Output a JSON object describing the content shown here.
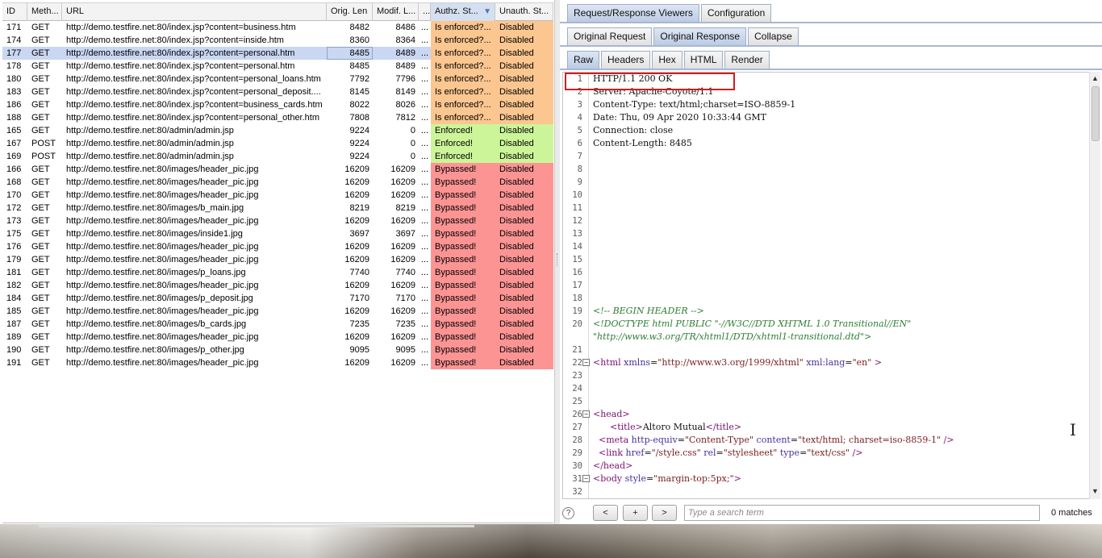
{
  "table": {
    "columns": {
      "id": "ID",
      "method": "Meth...",
      "url": "URL",
      "orig_len": "Orig. Len",
      "modif_len": "Modif. L...",
      "dots": "...",
      "authz": "Authz. St...",
      "unauth": "Unauth. St..."
    },
    "sort_indicator": "▼",
    "rows": [
      {
        "id": "171",
        "method": "GET",
        "url": "http://demo.testfire.net:80/index.jsp?content=business.htm",
        "orig": "8482",
        "modif": "8486",
        "dots": "...",
        "authz": "Is enforced?...",
        "unauth": "Disabled",
        "status": "orange"
      },
      {
        "id": "174",
        "method": "GET",
        "url": "http://demo.testfire.net:80/index.jsp?content=inside.htm",
        "orig": "8360",
        "modif": "8364",
        "dots": "...",
        "authz": "Is enforced?...",
        "unauth": "Disabled",
        "status": "orange"
      },
      {
        "id": "177",
        "method": "GET",
        "url": "http://demo.testfire.net:80/index.jsp?content=personal.htm",
        "orig": "8485",
        "modif": "8489",
        "dots": "...",
        "authz": "Is enforced?...",
        "unauth": "Disabled",
        "status": "orange",
        "selected": true
      },
      {
        "id": "178",
        "method": "GET",
        "url": "http://demo.testfire.net:80/index.jsp?content=personal.htm",
        "orig": "8485",
        "modif": "8489",
        "dots": "...",
        "authz": "Is enforced?...",
        "unauth": "Disabled",
        "status": "orange"
      },
      {
        "id": "180",
        "method": "GET",
        "url": "http://demo.testfire.net:80/index.jsp?content=personal_loans.htm",
        "orig": "7792",
        "modif": "7796",
        "dots": "...",
        "authz": "Is enforced?...",
        "unauth": "Disabled",
        "status": "orange"
      },
      {
        "id": "183",
        "method": "GET",
        "url": "http://demo.testfire.net:80/index.jsp?content=personal_deposit....",
        "orig": "8145",
        "modif": "8149",
        "dots": "...",
        "authz": "Is enforced?...",
        "unauth": "Disabled",
        "status": "orange"
      },
      {
        "id": "186",
        "method": "GET",
        "url": "http://demo.testfire.net:80/index.jsp?content=business_cards.htm",
        "orig": "8022",
        "modif": "8026",
        "dots": "...",
        "authz": "Is enforced?...",
        "unauth": "Disabled",
        "status": "orange"
      },
      {
        "id": "188",
        "method": "GET",
        "url": "http://demo.testfire.net:80/index.jsp?content=personal_other.htm",
        "orig": "7808",
        "modif": "7812",
        "dots": "...",
        "authz": "Is enforced?...",
        "unauth": "Disabled",
        "status": "orange"
      },
      {
        "id": "165",
        "method": "GET",
        "url": "http://demo.testfire.net:80/admin/admin.jsp",
        "orig": "9224",
        "modif": "0",
        "dots": "...",
        "authz": "Enforced!",
        "unauth": "Disabled",
        "status": "green"
      },
      {
        "id": "167",
        "method": "POST",
        "url": "http://demo.testfire.net:80/admin/admin.jsp",
        "orig": "9224",
        "modif": "0",
        "dots": "...",
        "authz": "Enforced!",
        "unauth": "Disabled",
        "status": "green"
      },
      {
        "id": "169",
        "method": "POST",
        "url": "http://demo.testfire.net:80/admin/admin.jsp",
        "orig": "9224",
        "modif": "0",
        "dots": "...",
        "authz": "Enforced!",
        "unauth": "Disabled",
        "status": "green"
      },
      {
        "id": "166",
        "method": "GET",
        "url": "http://demo.testfire.net:80/images/header_pic.jpg",
        "orig": "16209",
        "modif": "16209",
        "dots": "...",
        "authz": "Bypassed!",
        "unauth": "Disabled",
        "status": "red"
      },
      {
        "id": "168",
        "method": "GET",
        "url": "http://demo.testfire.net:80/images/header_pic.jpg",
        "orig": "16209",
        "modif": "16209",
        "dots": "...",
        "authz": "Bypassed!",
        "unauth": "Disabled",
        "status": "red"
      },
      {
        "id": "170",
        "method": "GET",
        "url": "http://demo.testfire.net:80/images/header_pic.jpg",
        "orig": "16209",
        "modif": "16209",
        "dots": "...",
        "authz": "Bypassed!",
        "unauth": "Disabled",
        "status": "red"
      },
      {
        "id": "172",
        "method": "GET",
        "url": "http://demo.testfire.net:80/images/b_main.jpg",
        "orig": "8219",
        "modif": "8219",
        "dots": "...",
        "authz": "Bypassed!",
        "unauth": "Disabled",
        "status": "red"
      },
      {
        "id": "173",
        "method": "GET",
        "url": "http://demo.testfire.net:80/images/header_pic.jpg",
        "orig": "16209",
        "modif": "16209",
        "dots": "...",
        "authz": "Bypassed!",
        "unauth": "Disabled",
        "status": "red"
      },
      {
        "id": "175",
        "method": "GET",
        "url": "http://demo.testfire.net:80/images/inside1.jpg",
        "orig": "3697",
        "modif": "3697",
        "dots": "...",
        "authz": "Bypassed!",
        "unauth": "Disabled",
        "status": "red"
      },
      {
        "id": "176",
        "method": "GET",
        "url": "http://demo.testfire.net:80/images/header_pic.jpg",
        "orig": "16209",
        "modif": "16209",
        "dots": "...",
        "authz": "Bypassed!",
        "unauth": "Disabled",
        "status": "red"
      },
      {
        "id": "179",
        "method": "GET",
        "url": "http://demo.testfire.net:80/images/header_pic.jpg",
        "orig": "16209",
        "modif": "16209",
        "dots": "...",
        "authz": "Bypassed!",
        "unauth": "Disabled",
        "status": "red"
      },
      {
        "id": "181",
        "method": "GET",
        "url": "http://demo.testfire.net:80/images/p_loans.jpg",
        "orig": "7740",
        "modif": "7740",
        "dots": "...",
        "authz": "Bypassed!",
        "unauth": "Disabled",
        "status": "red"
      },
      {
        "id": "182",
        "method": "GET",
        "url": "http://demo.testfire.net:80/images/header_pic.jpg",
        "orig": "16209",
        "modif": "16209",
        "dots": "...",
        "authz": "Bypassed!",
        "unauth": "Disabled",
        "status": "red"
      },
      {
        "id": "184",
        "method": "GET",
        "url": "http://demo.testfire.net:80/images/p_deposit.jpg",
        "orig": "7170",
        "modif": "7170",
        "dots": "...",
        "authz": "Bypassed!",
        "unauth": "Disabled",
        "status": "red"
      },
      {
        "id": "185",
        "method": "GET",
        "url": "http://demo.testfire.net:80/images/header_pic.jpg",
        "orig": "16209",
        "modif": "16209",
        "dots": "...",
        "authz": "Bypassed!",
        "unauth": "Disabled",
        "status": "red"
      },
      {
        "id": "187",
        "method": "GET",
        "url": "http://demo.testfire.net:80/images/b_cards.jpg",
        "orig": "7235",
        "modif": "7235",
        "dots": "...",
        "authz": "Bypassed!",
        "unauth": "Disabled",
        "status": "red"
      },
      {
        "id": "189",
        "method": "GET",
        "url": "http://demo.testfire.net:80/images/header_pic.jpg",
        "orig": "16209",
        "modif": "16209",
        "dots": "...",
        "authz": "Bypassed!",
        "unauth": "Disabled",
        "status": "red"
      },
      {
        "id": "190",
        "method": "GET",
        "url": "http://demo.testfire.net:80/images/p_other.jpg",
        "orig": "9095",
        "modif": "9095",
        "dots": "...",
        "authz": "Bypassed!",
        "unauth": "Disabled",
        "status": "red"
      },
      {
        "id": "191",
        "method": "GET",
        "url": "http://demo.testfire.net:80/images/header_pic.jpg",
        "orig": "16209",
        "modif": "16209",
        "dots": "...",
        "authz": "Bypassed!",
        "unauth": "Disabled",
        "status": "red"
      }
    ]
  },
  "status_colors": {
    "orange": "#fbc690",
    "green": "#ccf599",
    "red": "#fd9494",
    "selected": "#c9d7f2"
  },
  "tabs": {
    "outer": [
      {
        "label": "Request/Response Viewers",
        "active": true
      },
      {
        "label": "Configuration",
        "active": false
      }
    ],
    "response": [
      {
        "label": "Original Request",
        "active": false
      },
      {
        "label": "Original Response",
        "active": true
      },
      {
        "label": "Collapse",
        "active": false
      }
    ],
    "view": [
      {
        "label": "Raw",
        "active": true
      },
      {
        "label": "Headers",
        "active": false
      },
      {
        "label": "Hex",
        "active": false
      },
      {
        "label": "HTML",
        "active": false
      },
      {
        "label": "Render",
        "active": false
      }
    ]
  },
  "editor": {
    "lines": [
      {
        "n": "1",
        "segs": [
          [
            "plain",
            "HTTP/1.1 200 OK"
          ]
        ]
      },
      {
        "n": "2",
        "segs": [
          [
            "plain",
            "Server: Apache-Coyote/1.1"
          ]
        ]
      },
      {
        "n": "3",
        "segs": [
          [
            "plain",
            "Content-Type: text/html;charset=ISO-8859-1"
          ]
        ]
      },
      {
        "n": "4",
        "segs": [
          [
            "plain",
            "Date: Thu, 09 Apr 2020 10:33:44 GMT"
          ]
        ]
      },
      {
        "n": "5",
        "segs": [
          [
            "plain",
            "Connection: close"
          ]
        ]
      },
      {
        "n": "6",
        "segs": [
          [
            "plain",
            "Content-Length: 8485"
          ]
        ]
      },
      {
        "n": "7",
        "segs": []
      },
      {
        "n": "8",
        "segs": []
      },
      {
        "n": "9",
        "segs": []
      },
      {
        "n": "10",
        "segs": []
      },
      {
        "n": "11",
        "segs": []
      },
      {
        "n": "12",
        "segs": []
      },
      {
        "n": "13",
        "segs": []
      },
      {
        "n": "14",
        "segs": []
      },
      {
        "n": "15",
        "segs": []
      },
      {
        "n": "16",
        "segs": []
      },
      {
        "n": "17",
        "segs": []
      },
      {
        "n": "18",
        "segs": []
      },
      {
        "n": "19",
        "segs": [
          [
            "comment",
            "<!-- BEGIN HEADER -->"
          ]
        ]
      },
      {
        "n": "20",
        "segs": [
          [
            "comment",
            "<!DOCTYPE html PUBLIC \"-//W3C//DTD XHTML 1.0 Transitional//EN\""
          ]
        ]
      },
      {
        "n": "",
        "segs": [
          [
            "comment",
            "\"http://www.w3.org/TR/xhtml1/DTD/xhtml1-transitional.dtd\">"
          ]
        ]
      },
      {
        "n": "21",
        "segs": []
      },
      {
        "n": "22",
        "fold": "−",
        "segs": [
          [
            "tag",
            "<html "
          ],
          [
            "attr",
            "xmlns"
          ],
          [
            "plain",
            "="
          ],
          [
            "val",
            "\"http://www.w3.org/1999/xhtml\""
          ],
          [
            "plain",
            " "
          ],
          [
            "attr",
            "xml:lang"
          ],
          [
            "plain",
            "="
          ],
          [
            "val",
            "\"en\""
          ],
          [
            "tag",
            " >"
          ]
        ]
      },
      {
        "n": "23",
        "segs": []
      },
      {
        "n": "24",
        "segs": []
      },
      {
        "n": "25",
        "segs": []
      },
      {
        "n": "26",
        "fold": "−",
        "segs": [
          [
            "tag",
            "<head>"
          ]
        ]
      },
      {
        "n": "27",
        "segs": [
          [
            "plain",
            "      "
          ],
          [
            "tag",
            "<title>"
          ],
          [
            "plain",
            "Altoro Mutual"
          ],
          [
            "tag",
            "</title>"
          ]
        ]
      },
      {
        "n": "28",
        "segs": [
          [
            "plain",
            "  "
          ],
          [
            "tag",
            "<meta "
          ],
          [
            "attr",
            "http-equiv"
          ],
          [
            "plain",
            "="
          ],
          [
            "val",
            "\"Content-Type\""
          ],
          [
            "plain",
            " "
          ],
          [
            "attr",
            "content"
          ],
          [
            "plain",
            "="
          ],
          [
            "val",
            "\"text/html; charset=iso-8859-1\""
          ],
          [
            "tag",
            " />"
          ]
        ]
      },
      {
        "n": "29",
        "segs": [
          [
            "plain",
            "  "
          ],
          [
            "tag",
            "<link "
          ],
          [
            "attr",
            "href"
          ],
          [
            "plain",
            "="
          ],
          [
            "val",
            "\"/style.css\""
          ],
          [
            "plain",
            " "
          ],
          [
            "attr",
            "rel"
          ],
          [
            "plain",
            "="
          ],
          [
            "val",
            "\"stylesheet\""
          ],
          [
            "plain",
            " "
          ],
          [
            "attr",
            "type"
          ],
          [
            "plain",
            "="
          ],
          [
            "val",
            "\"text/css\""
          ],
          [
            "tag",
            " />"
          ]
        ]
      },
      {
        "n": "30",
        "segs": [
          [
            "tag",
            "</head>"
          ]
        ]
      },
      {
        "n": "31",
        "fold": "−",
        "segs": [
          [
            "tag",
            "<body "
          ],
          [
            "attr",
            "style"
          ],
          [
            "plain",
            "="
          ],
          [
            "val",
            "\"margin-top:5px;\""
          ],
          [
            "tag",
            ">"
          ]
        ]
      },
      {
        "n": "32",
        "segs": []
      }
    ]
  },
  "search": {
    "help_icon": "?",
    "prev_label": "<",
    "plus_label": "+",
    "next_label": ">",
    "placeholder": "Type a search term",
    "value": "",
    "matches": "0 matches"
  },
  "scrollbar": {
    "up_icon": "▲",
    "down_icon": "▼"
  },
  "cursor_glyph": "I"
}
